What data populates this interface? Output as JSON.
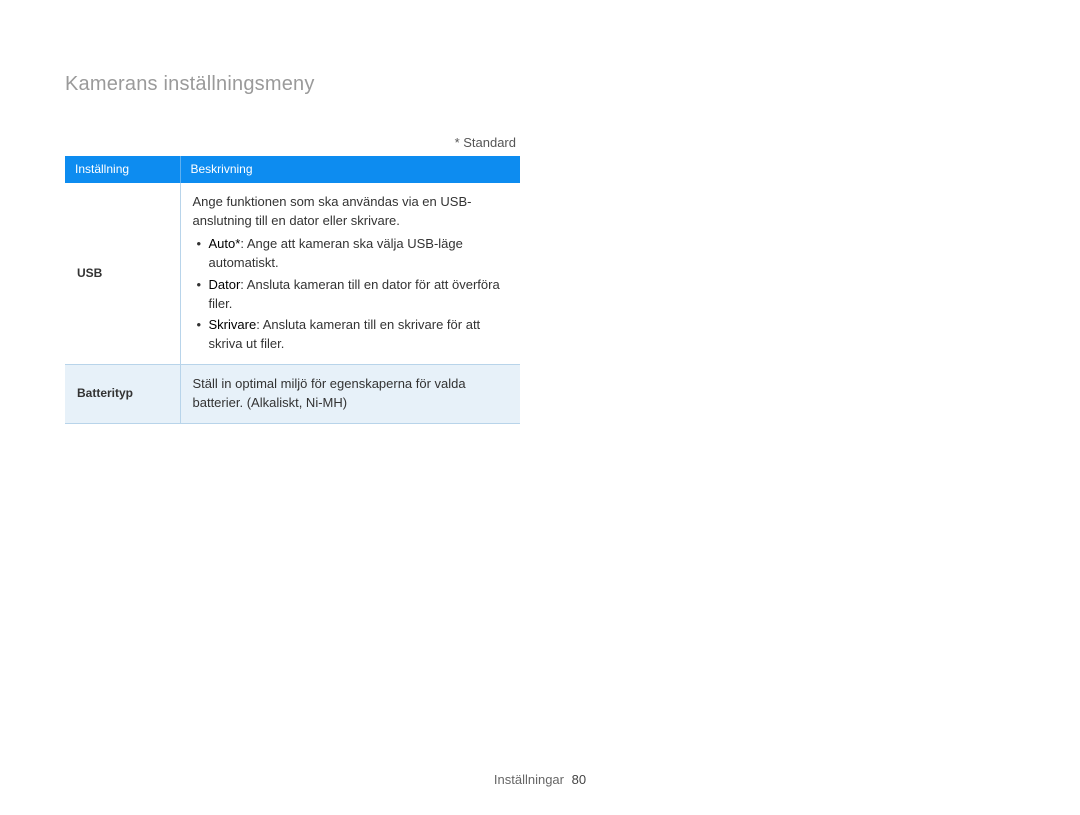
{
  "page": {
    "title": "Kamerans inställningsmeny",
    "standard_note": "* Standard"
  },
  "table": {
    "headers": {
      "setting": "Inställning",
      "description": "Beskrivning"
    },
    "rows": {
      "usb": {
        "name": "USB",
        "intro": "Ange funktionen som ska användas via en USB-anslutning till en dator eller skrivare.",
        "options": [
          {
            "label": "Auto*",
            "text": ": Ange att kameran ska välja USB-läge automatiskt."
          },
          {
            "label": "Dator",
            "text": ": Ansluta kameran till en dator för att överföra filer."
          },
          {
            "label": "Skrivare",
            "text": ": Ansluta kameran till en skrivare för att skriva ut filer."
          }
        ]
      },
      "battery": {
        "name": "Batterityp",
        "text_before": "Ställ in optimal miljö för egenskaperna för valda batterier. (",
        "options_text": "Alkaliskt, Ni-MH",
        "text_after": ")"
      }
    }
  },
  "footer": {
    "section": "Inställningar",
    "page_number": "80"
  }
}
